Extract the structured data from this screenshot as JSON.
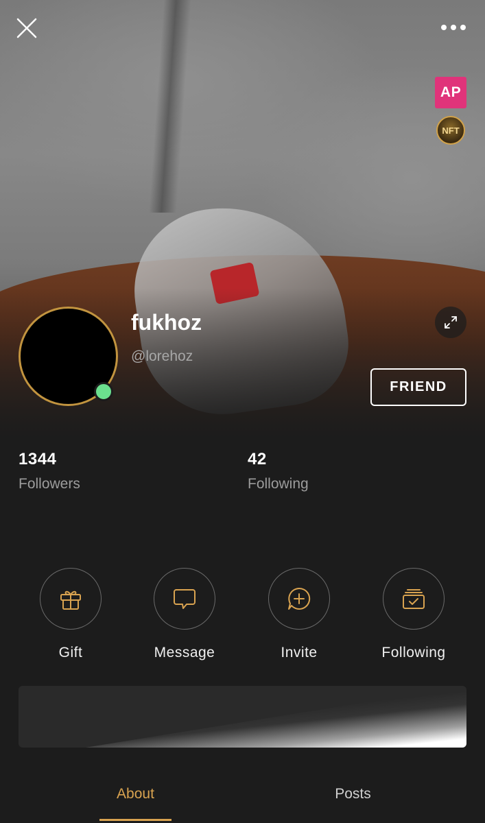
{
  "header": {
    "close_icon": "close-icon",
    "more_icon": "more-dots-icon",
    "badges": {
      "ap_label": "AP",
      "nft_label": "NFT"
    }
  },
  "profile": {
    "display_name": "fukhoz",
    "username": "@lorehoz",
    "online": true,
    "friend_button_label": "FRIEND",
    "expand_icon": "expand-icon"
  },
  "stats": {
    "followers": {
      "value": "1344",
      "label": "Followers"
    },
    "following": {
      "value": "42",
      "label": "Following"
    }
  },
  "actions": [
    {
      "label": "Gift",
      "icon": "gift-icon"
    },
    {
      "label": "Message",
      "icon": "message-icon"
    },
    {
      "label": "Invite",
      "icon": "invite-icon"
    },
    {
      "label": "Following",
      "icon": "following-icon"
    }
  ],
  "tabs": [
    {
      "label": "About",
      "active": true
    },
    {
      "label": "Posts",
      "active": false
    }
  ],
  "colors": {
    "accent": "#d9a350",
    "background": "#1c1c1c",
    "online": "#6be08e",
    "ap_badge": "#e0337a"
  }
}
